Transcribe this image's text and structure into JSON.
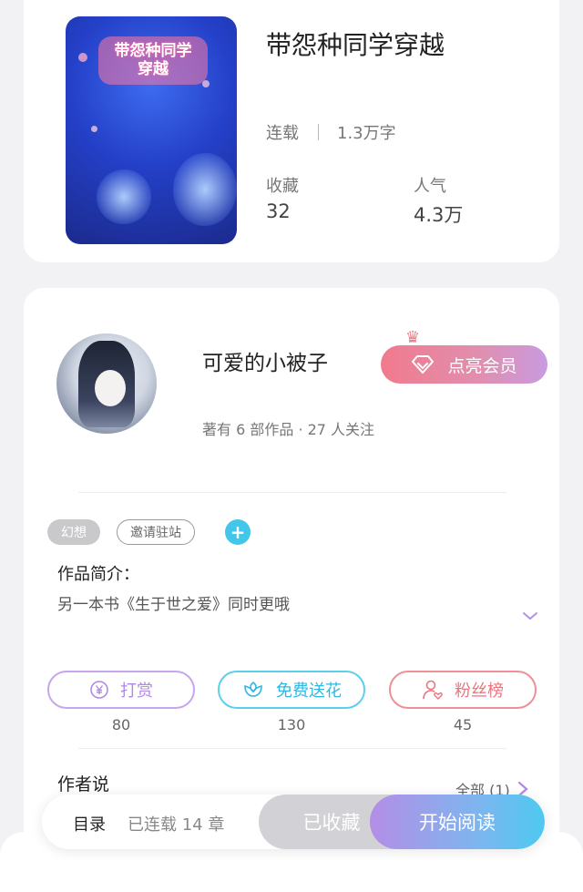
{
  "book": {
    "cover_title_line1": "带怨种同学",
    "cover_title_line2": "穿越",
    "title": "带怨种同学穿越",
    "status": "连载",
    "words": "1.3万字",
    "favorites_label": "收藏",
    "favorites_value": "32",
    "popularity_label": "人气",
    "popularity_value": "4.3万"
  },
  "author": {
    "name": "可爱的小被子",
    "info": "著有 6 部作品 · 27 人关注",
    "member_button": "点亮会员",
    "tags": {
      "genre": "幻想",
      "invite": "邀请驻站",
      "add": "+"
    },
    "intro_label": "作品简介：",
    "intro_text": "另一本书《生于世之爱》同时更哦",
    "actions": {
      "reward_label": "打赏",
      "reward_count": "80",
      "flower_label": "免费送花",
      "flower_count": "130",
      "fans_label": "粉丝榜",
      "fans_count": "45"
    },
    "author_says_label": "作者说",
    "all_label": "全部 (1)"
  },
  "bottom_bar": {
    "toc_label": "目录",
    "toc_chapters": "已连载 14 章",
    "collected_label": "已收藏",
    "read_label": "开始阅读"
  },
  "colors": {
    "accent_blue": "#42c6ea",
    "member_pink": "#f17a8c",
    "reward_purple": "#b089e4",
    "flower_blue": "#2fb7e3",
    "fans_red": "#e8757f"
  }
}
